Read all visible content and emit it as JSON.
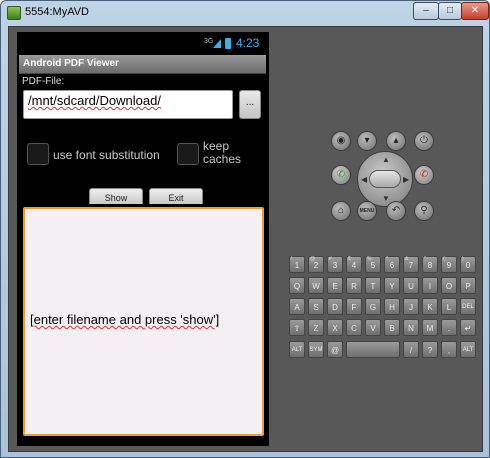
{
  "window": {
    "title": "5554:MyAVD"
  },
  "statusbar": {
    "network": "3G",
    "time": "4:23"
  },
  "app": {
    "title": "Android PDF Viewer",
    "pdf_file_label": "PDF-File:",
    "file_path": "/mnt/sdcard/Download/",
    "file_path_hint": "................................................",
    "browse_label": "...",
    "checkbox_font_label": "use font substitution",
    "checkbox_cache_label": "keep caches",
    "show_button": "Show",
    "exit_button": "Exit",
    "content_text": "[enter filename and press 'show']"
  },
  "controls": {
    "camera": "camera-icon",
    "vol_down": "volume-down-icon",
    "vol_up": "volume-up-icon",
    "power": "power-icon",
    "menu_label": "MENU"
  },
  "keyboard": {
    "row1": [
      [
        "1",
        "!"
      ],
      [
        "2",
        "@"
      ],
      [
        "3",
        "#"
      ],
      [
        "4",
        "$"
      ],
      [
        "5",
        "%"
      ],
      [
        "6",
        "^"
      ],
      [
        "7",
        "&"
      ],
      [
        "8",
        "*"
      ],
      [
        "9",
        "("
      ],
      [
        "0",
        ")"
      ]
    ],
    "row2": [
      "Q",
      "W",
      "E",
      "R",
      "T",
      "Y",
      "U",
      "I",
      "O",
      "P"
    ],
    "row3": [
      "A",
      "S",
      "D",
      "F",
      "G",
      "H",
      "J",
      "K",
      "L",
      "DEL"
    ],
    "row4": [
      "⇧",
      "Z",
      "X",
      "C",
      "V",
      "B",
      "N",
      "M",
      ".",
      "↵"
    ],
    "row5_left": [
      "ALT",
      "SYM",
      "@"
    ],
    "row5_right": [
      "/",
      "?",
      ",",
      "ALT"
    ]
  }
}
